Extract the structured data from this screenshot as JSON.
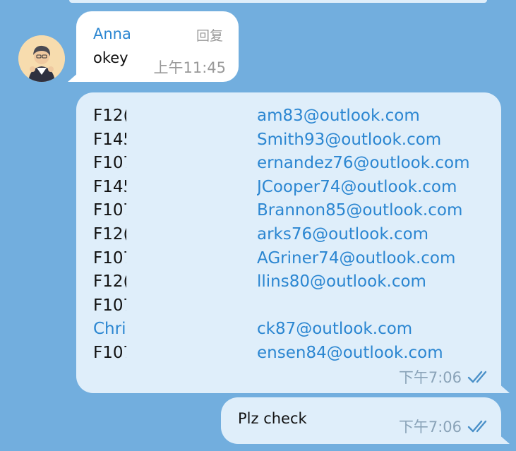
{
  "incoming": {
    "sender": "Anna",
    "reply_label": "回复",
    "text": "okey",
    "time": "上午11:45"
  },
  "list_message": {
    "rows": [
      {
        "code": "F12(",
        "email": "am83@outlook.com",
        "code_is_link": false
      },
      {
        "code": "F145",
        "email": "Smith93@outlook.com",
        "code_is_link": false
      },
      {
        "code": "F107",
        "email": "ernandez76@outlook.com",
        "code_is_link": false
      },
      {
        "code": "F145",
        "email": "JCooper74@outlook.com",
        "code_is_link": false
      },
      {
        "code": "F107",
        "email": "Brannon85@outlook.com",
        "code_is_link": false
      },
      {
        "code": "F12(",
        "email": "arks76@outlook.com",
        "code_is_link": false
      },
      {
        "code": "F107",
        "email": "AGriner74@outlook.com",
        "code_is_link": false
      },
      {
        "code": "F12(",
        "email": "llins80@outlook.com",
        "code_is_link": false
      },
      {
        "code": "F107",
        "email": "",
        "code_is_link": false
      },
      {
        "code": "Chri",
        "email": "ck87@outlook.com",
        "code_is_link": true
      },
      {
        "code": "F107",
        "email": "ensen84@outlook.com",
        "code_is_link": false
      }
    ],
    "time": "下午7:06",
    "read_icon": "double-check-icon"
  },
  "outgoing": {
    "text": "Plz check",
    "time": "下午7:06",
    "read_icon": "double-check-icon"
  },
  "colors": {
    "background": "#72aede",
    "incoming_bubble": "#ffffff",
    "outgoing_bubble": "#dfeefa",
    "link": "#2b86d1",
    "check": "#4a90c8"
  }
}
